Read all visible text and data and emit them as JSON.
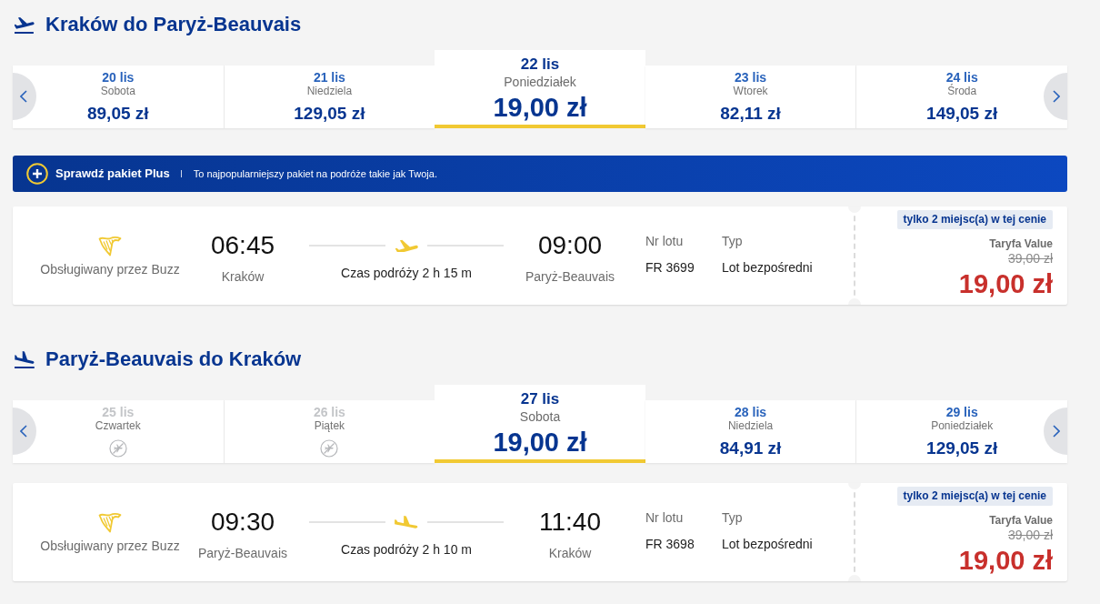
{
  "sections": [
    {
      "kind": "outbound",
      "heading": "Kraków do Paryż-Beauvais",
      "dates": [
        {
          "date": "20 lis",
          "day": "Sobota",
          "price": "89,05 zł",
          "available": true,
          "selected": false
        },
        {
          "date": "21 lis",
          "day": "Niedziela",
          "price": "129,05 zł",
          "available": true,
          "selected": false
        },
        {
          "date": "22 lis",
          "day": "Poniedziałek",
          "price": "19,00 zł",
          "available": true,
          "selected": true
        },
        {
          "date": "23 lis",
          "day": "Wtorek",
          "price": "82,11 zł",
          "available": true,
          "selected": false
        },
        {
          "date": "24 lis",
          "day": "Środa",
          "price": "149,05 zł",
          "available": true,
          "selected": false
        }
      ],
      "promo": {
        "title": "Sprawdź pakiet Plus",
        "text": "To najpopularniejszy pakiet na podróże takie jak Twoja."
      },
      "flight": {
        "operator": "Obsługiwany przez Buzz",
        "departure_time": "06:45",
        "departure_city": "Kraków",
        "duration": "Czas podróży 2 h 15 m",
        "arrival_time": "09:00",
        "arrival_city": "Paryż-Beauvais",
        "flight_number_label": "Nr lotu",
        "flight_number": "FR 3699",
        "type_label": "Typ",
        "type": "Lot bezpośredni",
        "badge": "tylko 2 miejsc(a) w tej cenie",
        "fare": "Taryfa Value",
        "old_price": "39,00 zł",
        "price": "19,00 zł"
      }
    },
    {
      "kind": "inbound",
      "heading": "Paryż-Beauvais do Kraków",
      "dates": [
        {
          "date": "25 lis",
          "day": "Czwartek",
          "available": false,
          "selected": false
        },
        {
          "date": "26 lis",
          "day": "Piątek",
          "available": false,
          "selected": false
        },
        {
          "date": "27 lis",
          "day": "Sobota",
          "price": "19,00 zł",
          "available": true,
          "selected": true
        },
        {
          "date": "28 lis",
          "day": "Niedziela",
          "price": "84,91 zł",
          "available": true,
          "selected": false
        },
        {
          "date": "29 lis",
          "day": "Poniedziałek",
          "price": "129,05 zł",
          "available": true,
          "selected": false
        }
      ],
      "flight": {
        "operator": "Obsługiwany przez Buzz",
        "departure_time": "09:30",
        "departure_city": "Paryż-Beauvais",
        "duration": "Czas podróży 2 h 10 m",
        "arrival_time": "11:40",
        "arrival_city": "Kraków",
        "flight_number_label": "Nr lotu",
        "flight_number": "FR 3698",
        "type_label": "Typ",
        "type": "Lot bezpośredni",
        "badge": "tylko 2 miejsc(a) w tej cenie",
        "fare": "Taryfa Value",
        "old_price": "39,00 zł",
        "price": "19,00 zł"
      }
    }
  ]
}
